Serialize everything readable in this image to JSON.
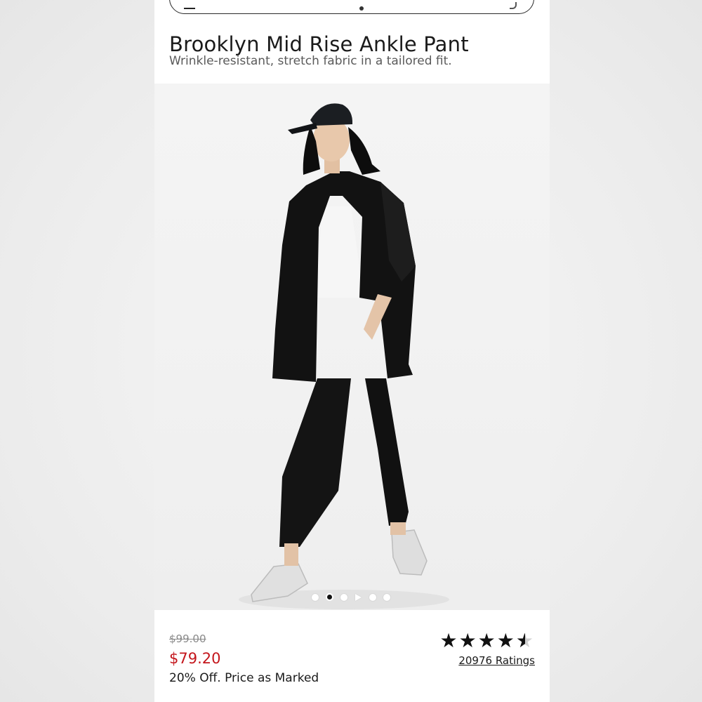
{
  "product": {
    "title": "Brooklyn Mid Rise Ankle Pant",
    "subtitle": "Wrinkle-resistant, stretch fabric in a tailored fit."
  },
  "carousel": {
    "total_items": 6,
    "active_index": 1,
    "video_index": 3
  },
  "pricing": {
    "original_price": "$99.00",
    "sale_price": "$79.20",
    "promo_text": "20% Off. Price as Marked",
    "sale_color": "#c4161c"
  },
  "reviews": {
    "star_rating": 4.5,
    "max_stars": 5,
    "ratings_link": "20976 Ratings"
  },
  "icons": {
    "stars": "star-icon",
    "video": "play-icon"
  }
}
